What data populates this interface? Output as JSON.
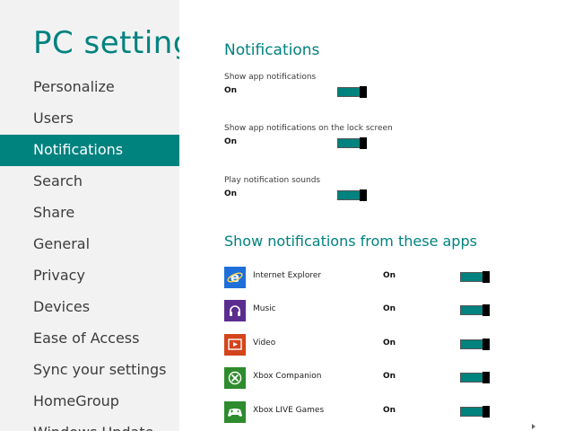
{
  "sidebar": {
    "title": "PC settings",
    "items": [
      {
        "label": "Personalize"
      },
      {
        "label": "Users"
      },
      {
        "label": "Notifications"
      },
      {
        "label": "Search"
      },
      {
        "label": "Share"
      },
      {
        "label": "General"
      },
      {
        "label": "Privacy"
      },
      {
        "label": "Devices"
      },
      {
        "label": "Ease of Access"
      },
      {
        "label": "Sync your settings"
      },
      {
        "label": "HomeGroup"
      },
      {
        "label": "Windows Update"
      }
    ],
    "selected": "Notifications"
  },
  "main": {
    "heading": "Notifications",
    "settings": [
      {
        "label": "Show app notifications",
        "state": "On"
      },
      {
        "label": "Show app notifications on the lock screen",
        "state": "On"
      },
      {
        "label": "Play notification sounds",
        "state": "On"
      }
    ],
    "apps_heading": "Show notifications from these apps",
    "apps": [
      {
        "name": "Internet Explorer",
        "state": "On",
        "icon": "internet-explorer-icon",
        "color": "#1e6fd9"
      },
      {
        "name": "Music",
        "state": "On",
        "icon": "headphones-icon",
        "color": "#5b2d90"
      },
      {
        "name": "Video",
        "state": "On",
        "icon": "video-play-icon",
        "color": "#d4441c"
      },
      {
        "name": "Xbox Companion",
        "state": "On",
        "icon": "xbox-icon",
        "color": "#2e8b2e"
      },
      {
        "name": "Xbox LIVE Games",
        "state": "On",
        "icon": "gamepad-icon",
        "color": "#2e8b2e"
      }
    ]
  },
  "colors": {
    "accent": "#00827f",
    "sidebar_bg": "#f2f2f2",
    "toggle_thumb": "#000000"
  }
}
